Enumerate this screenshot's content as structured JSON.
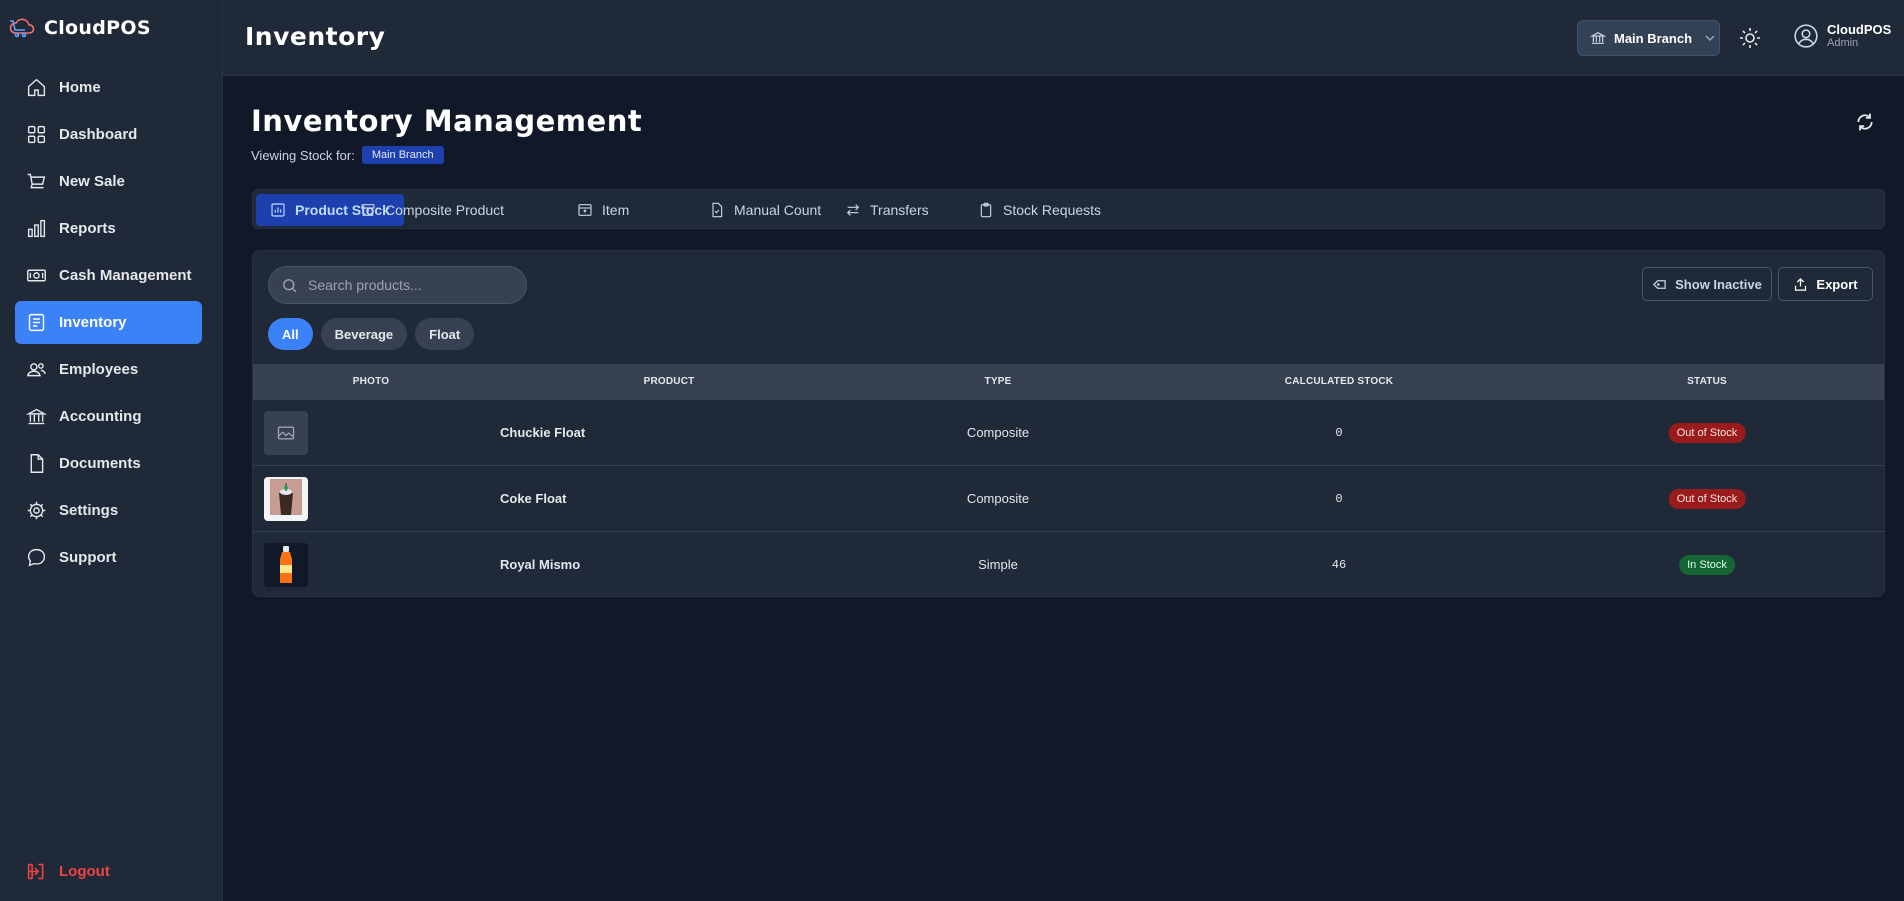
{
  "app": {
    "name": "CloudPOS"
  },
  "sidebar": {
    "items": [
      {
        "label": "Home",
        "icon": "home-icon"
      },
      {
        "label": "Dashboard",
        "icon": "grid-icon"
      },
      {
        "label": "New Sale",
        "icon": "cart-icon"
      },
      {
        "label": "Reports",
        "icon": "bar-chart-icon"
      },
      {
        "label": "Cash Management",
        "icon": "cash-icon"
      },
      {
        "label": "Inventory",
        "icon": "clipboard-list-icon",
        "active": true
      },
      {
        "label": "Employees",
        "icon": "users-icon"
      },
      {
        "label": "Accounting",
        "icon": "bank-icon"
      },
      {
        "label": "Documents",
        "icon": "document-icon"
      },
      {
        "label": "Settings",
        "icon": "gear-icon"
      },
      {
        "label": "Support",
        "icon": "chat-icon"
      }
    ],
    "logout": "Logout"
  },
  "topbar": {
    "title": "Inventory",
    "branch": "Main Branch",
    "user": {
      "name": "CloudPOS",
      "role": "Admin"
    }
  },
  "main": {
    "title": "Inventory Management",
    "viewing_label": "Viewing Stock for:",
    "viewing_branch": "Main Branch",
    "tabs": [
      {
        "label": "Product Stock",
        "icon": "chart-icon",
        "active": true
      },
      {
        "label": "Composite Product",
        "icon": "archive-icon"
      },
      {
        "label": "Item",
        "icon": "box-icon"
      },
      {
        "label": "Manual Count",
        "icon": "file-check-icon"
      },
      {
        "label": "Transfers",
        "icon": "arrows-icon"
      },
      {
        "label": "Stock Requests",
        "icon": "clipboard-icon"
      }
    ],
    "search_placeholder": "Search products...",
    "show_inactive": "Show Inactive",
    "export": "Export",
    "filters": [
      {
        "label": "All",
        "active": true
      },
      {
        "label": "Beverage"
      },
      {
        "label": "Float"
      }
    ],
    "table": {
      "headers": [
        "Photo",
        "Product",
        "Type",
        "Calculated Stock",
        "Status"
      ],
      "rows": [
        {
          "product": "Chuckie Float",
          "type": "Composite",
          "stock": "0",
          "status": "Out of Stock",
          "status_kind": "out",
          "photo": "placeholder-image-icon"
        },
        {
          "product": "Coke Float",
          "type": "Composite",
          "stock": "0",
          "status": "Out of Stock",
          "status_kind": "out",
          "photo": "coke-float-photo"
        },
        {
          "product": "Royal Mismo",
          "type": "Simple",
          "stock": "46",
          "status": "In Stock",
          "status_kind": "in",
          "photo": "royal-bottle-photo"
        }
      ]
    }
  },
  "colors": {
    "accent": "#3b82f6",
    "danger": "#991b1b",
    "success": "#166534",
    "logout": "#ef4444"
  }
}
